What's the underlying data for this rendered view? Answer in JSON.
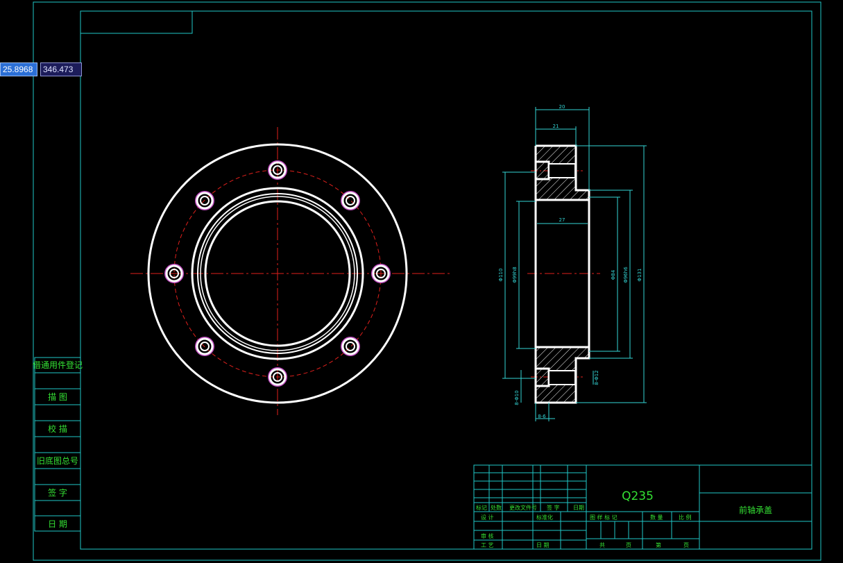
{
  "coordinate_input": {
    "x_value": "25.8968",
    "y_value": "346.473"
  },
  "side_table": {
    "rows": [
      "借通用件登记",
      "描 图",
      "校 描",
      "旧底图总号",
      "签 字",
      "日 期"
    ]
  },
  "dimensions": {
    "top_width": "20",
    "top_step": "21",
    "bore_depth": "27",
    "od_large": "Φ110",
    "od_left_inner": "Φ99h8",
    "bore": "Φ84",
    "od_right_mid": "Φ96h6",
    "od_outer": "Φ131",
    "hole_dia": "8-Φ10",
    "hole_depth": "8-Φ12",
    "hole_bottom": "8-6"
  },
  "title_block": {
    "material": "Q235",
    "part_name": "前轴承盖",
    "revision_header": [
      "标记",
      "处数",
      "更改文件号",
      "签 字",
      "日期"
    ],
    "design": "设 计",
    "standardization": "标准化",
    "check": "审 核",
    "process": "工 艺",
    "date": "日 期",
    "drawing_mark": "图 样 标 记",
    "weight": "数 量",
    "scale": "比 例",
    "total": "共",
    "sheet": "页",
    "page_no": "第",
    "page_unit": "页"
  },
  "colors": {
    "border": "#21c7c7",
    "outline": "#ffffff",
    "centerline": "#e0201c",
    "dimension": "#34d6d6",
    "text": "#34e034",
    "hole_ring": "#c050c0"
  }
}
